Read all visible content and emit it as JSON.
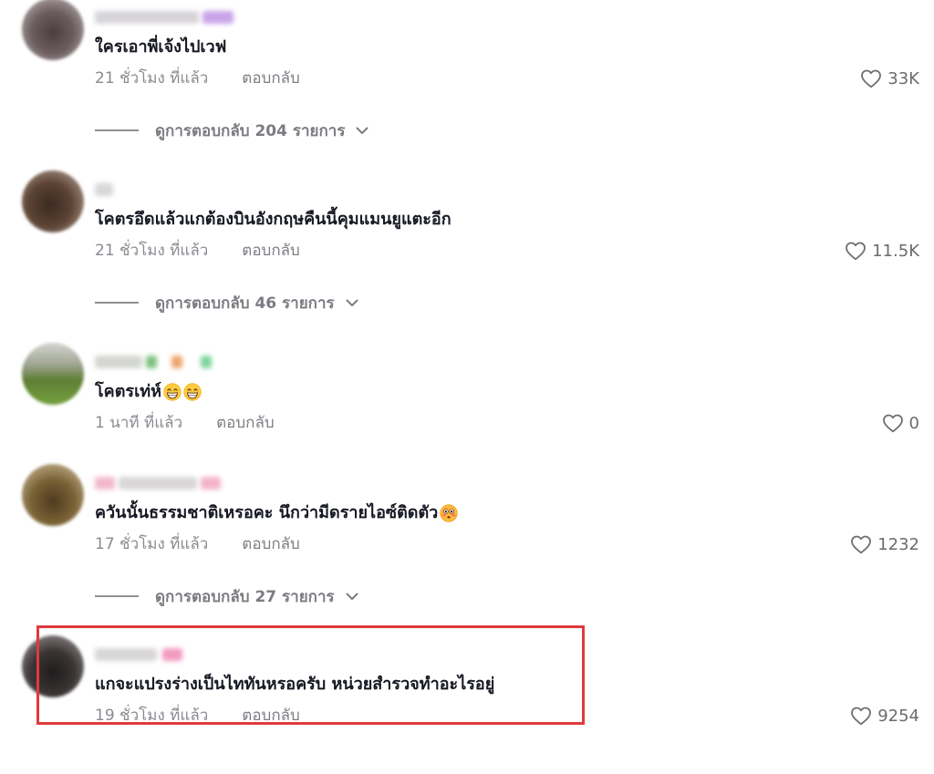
{
  "comments": [
    {
      "text": "ใครเอาพี่เจ้งไปเวฟ",
      "time": "21 ชั่วโมง ที่แล้ว",
      "reply_label": "ตอบกลับ",
      "likes": "33K",
      "replies_label": "ดูการตอบกลับ 204 รายการ"
    },
    {
      "text": "โคตรอึดแล้วแกต้องบินอังกฤษคืนนี้คุมแมนยูแตะอีก",
      "time": "21 ชั่วโมง ที่แล้ว",
      "reply_label": "ตอบกลับ",
      "likes": "11.5K",
      "replies_label": "ดูการตอบกลับ 46 รายการ"
    },
    {
      "text": "โคตรเท่ห์",
      "emojis": [
        "grinning-face-with-smiling-eyes-emoji-icon",
        "grinning-face-with-smiling-eyes-emoji-icon"
      ],
      "time": "1 นาที ที่แล้ว",
      "reply_label": "ตอบกลับ",
      "likes": "0"
    },
    {
      "text": "ควันนั้นธรรมชาติเหรอคะ นึกว่ามีดรายไอซ์ติดตัว",
      "emojis": [
        "flushed-face-emoji-icon"
      ],
      "time": "17 ชั่วโมง ที่แล้ว",
      "reply_label": "ตอบกลับ",
      "likes": "1232",
      "replies_label": "ดูการตอบกลับ 27 รายการ"
    },
    {
      "text": "แกจะแปรงร่างเป็นไททันหรอครับ หน่วยสำรวจทำอะไรอยู่",
      "time": "19 ชั่วโมง ที่แล้ว",
      "reply_label": "ตอบกลับ",
      "likes": "9254"
    }
  ],
  "icons": {
    "like": "heart-outline-icon",
    "expand_replies": "chevron-down-icon",
    "avatar": "avatar-blurred",
    "username": "username-blurred"
  },
  "colors": {
    "highlight_box": "#e03a3e",
    "comment_text": "#161823",
    "meta_text": "#8a8b91",
    "likes_text": "#6b6b70",
    "replies_text": "#7b7c82"
  }
}
